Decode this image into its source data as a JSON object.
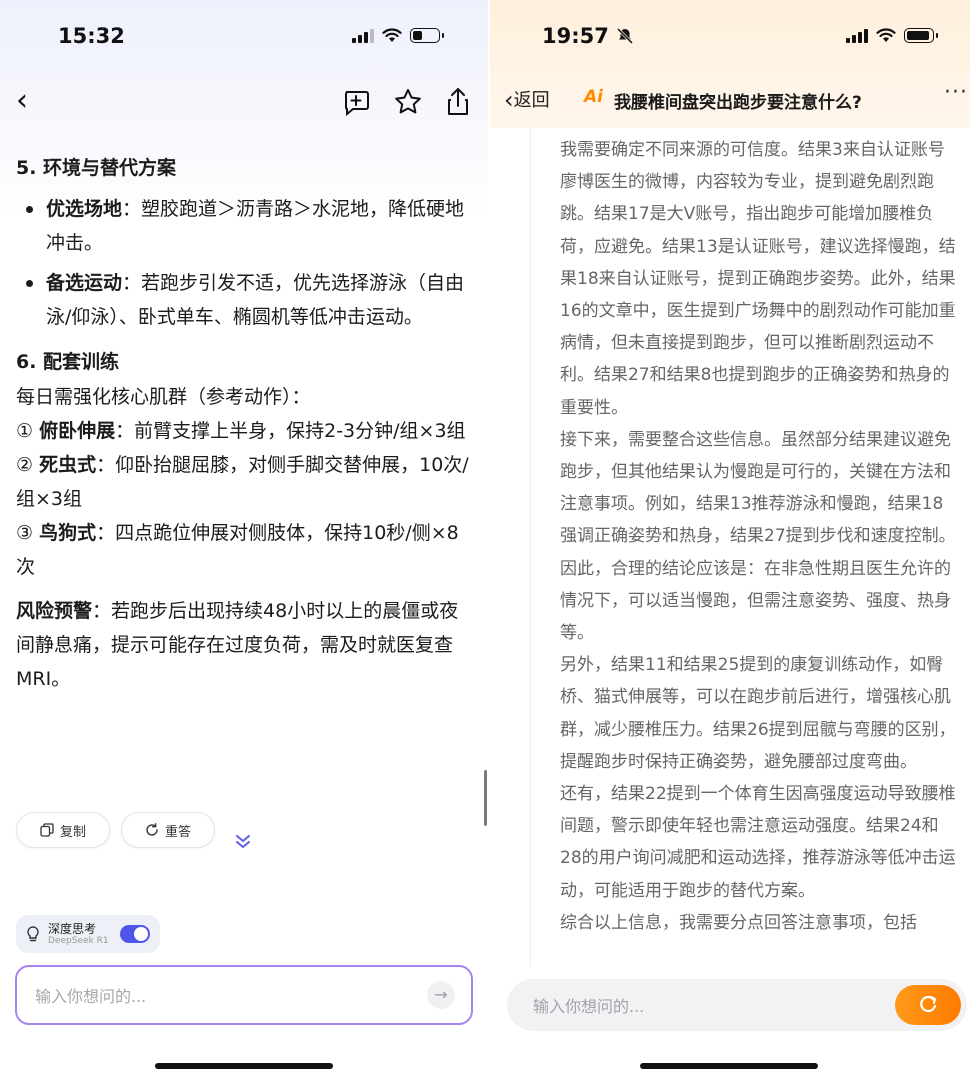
{
  "left": {
    "status_time": "15:32",
    "section5_title": "5. 环境与替代方案",
    "bullets": [
      {
        "bold": "优选场地",
        "text": "：塑胶跑道＞沥青路＞水泥地，降低硬地冲击。"
      },
      {
        "bold": "备选运动",
        "text": "：若跑步引发不适，优先选择游泳（自由泳/仰泳）、卧式单车、椭圆机等低冲击运动。"
      }
    ],
    "section6_title": "6. 配套训练",
    "section6_intro": "每日需强化核心肌群（参考动作）：",
    "exercises": [
      {
        "num": "①",
        "bold": "俯卧伸展",
        "text": "：前臂支撑上半身，保持2-3分钟/组×3组"
      },
      {
        "num": "②",
        "bold": "死虫式",
        "text": "：仰卧抬腿屈膝，对侧手脚交替伸展，10次/组×3组"
      },
      {
        "num": "③",
        "bold": "鸟狗式",
        "text": "：四点跪位伸展对侧肢体，保持10秒/侧×8次"
      }
    ],
    "warning_bold": "风险预警",
    "warning_text": "：若跑步后出现持续48小时以上的晨僵或夜间静息痛，提示可能存在过度负荷，需及时就医复查MRI。",
    "copy_label": "复制",
    "regen_label": "重答",
    "deep_title": "深度思考",
    "deep_sub": "DeepSeek R1",
    "deep_toggle_on": true,
    "input_placeholder": "输入你想问的...",
    "accent": "#4f55e8",
    "input_border": "#a583f2"
  },
  "right": {
    "status_time": "19:57",
    "back_label": "返回",
    "ai_badge": "Ai",
    "title": "我腰椎间盘突出跑步要注意什么?",
    "paragraphs": [
      "我需要确定不同来源的可信度。结果3来自认证账号廖博医生的微博，内容较为专业，提到避免剧烈跑跳。结果17是大V账号，指出跑步可能增加腰椎负荷，应避免。结果13是认证账号，建议选择慢跑，结果18来自认证账号，提到正确跑步姿势。此外，结果16的文章中，医生提到广场舞中的剧烈动作可能加重病情，但未直接提到跑步，但可以推断剧烈运动不利。结果27和结果8也提到跑步的正确姿势和热身的重要性。",
      "接下来，需要整合这些信息。虽然部分结果建议避免跑步，但其他结果认为慢跑是可行的，关键在方法和注意事项。例如，结果13推荐游泳和慢跑，结果18强调正确姿势和热身，结果27提到步伐和速度控制。因此，合理的结论应该是：在非急性期且医生允许的情况下，可以适当慢跑，但需注意姿势、强度、热身等。",
      "另外，结果11和结果25提到的康复训练动作，如臀桥、猫式伸展等，可以在跑步前后进行，增强核心肌群，减少腰椎压力。结果26提到屈髋与弯腰的区别，提醒跑步时保持正确姿势，避免腰部过度弯曲。",
      "还有，结果22提到一个体育生因高强度运动导致腰椎间题，警示即使年轻也需注意运动强度。结果24和28的用户询问减肥和运动选择，推荐游泳等低冲击运动，可能适用于跑步的替代方案。",
      "综合以上信息，我需要分点回答注意事项，包括"
    ],
    "input_placeholder": "输入你想问的...",
    "accent": "#ff8a00"
  }
}
